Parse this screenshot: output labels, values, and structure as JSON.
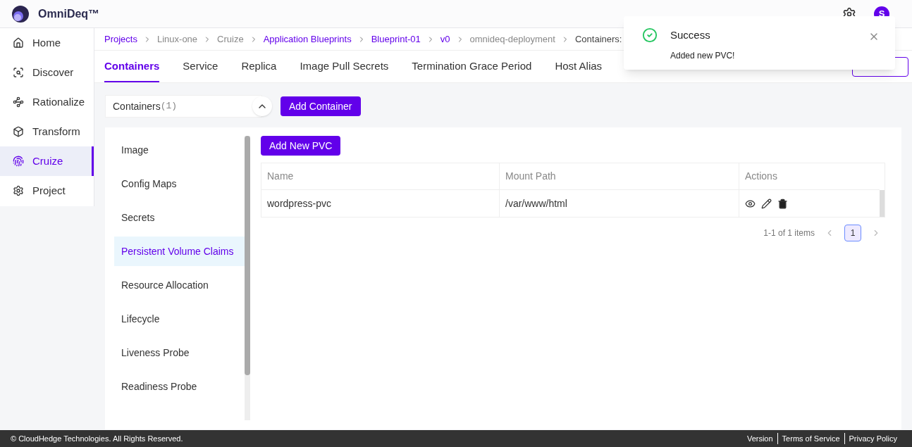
{
  "app": {
    "name": "OmniDeq™",
    "avatar": "S"
  },
  "sidebar": {
    "items": [
      {
        "label": "Home",
        "selected": false
      },
      {
        "label": "Discover",
        "selected": false
      },
      {
        "label": "Rationalize",
        "selected": false
      },
      {
        "label": "Transform",
        "selected": false
      },
      {
        "label": "Cruize",
        "selected": true
      },
      {
        "label": "Project",
        "selected": false
      }
    ]
  },
  "breadcrumb": [
    {
      "label": "Projects",
      "link": true
    },
    {
      "label": "Linux-one",
      "link": false
    },
    {
      "label": "Cruize",
      "link": false
    },
    {
      "label": "Application Blueprints",
      "link": true
    },
    {
      "label": "Blueprint-01",
      "link": true
    },
    {
      "label": "v0",
      "link": true
    },
    {
      "label": "omnideq-deployment",
      "link": false
    },
    {
      "label": "Containers:",
      "link": false
    }
  ],
  "tabs": [
    {
      "label": "Containers",
      "selected": true
    },
    {
      "label": "Service",
      "selected": false
    },
    {
      "label": "Replica",
      "selected": false
    },
    {
      "label": "Image Pull Secrets",
      "selected": false
    },
    {
      "label": "Termination Grace Period",
      "selected": false
    },
    {
      "label": "Host Alias",
      "selected": false
    }
  ],
  "containers": {
    "label": "Containers",
    "count": "(1)",
    "expanded": true,
    "add_button": "Add Container"
  },
  "section_menu": [
    {
      "label": "Image",
      "selected": false
    },
    {
      "label": "Config Maps",
      "selected": false
    },
    {
      "label": "Secrets",
      "selected": false
    },
    {
      "label": "Persistent Volume Claims",
      "selected": true
    },
    {
      "label": "Resource Allocation",
      "selected": false
    },
    {
      "label": "Lifecycle",
      "selected": false
    },
    {
      "label": "Liveness Probe",
      "selected": false
    },
    {
      "label": "Readiness Probe",
      "selected": false
    }
  ],
  "pvc": {
    "add_button": "Add New PVC",
    "columns": [
      "Name",
      "Mount Path",
      "Actions"
    ],
    "rows": [
      {
        "name": "wordpress-pvc",
        "mount_path": "/var/www/html"
      }
    ],
    "pagination": {
      "summary": "1-1 of 1 items",
      "pages": [
        {
          "label": "1",
          "selected": true
        }
      ]
    }
  },
  "toast": {
    "title": "Success",
    "message": "Added new PVC!"
  },
  "footer": {
    "copyright": "© CloudHedge Technologies. All Rights Reserved.",
    "links": [
      "Version",
      "Terms of Service",
      "Privacy Policy"
    ]
  }
}
